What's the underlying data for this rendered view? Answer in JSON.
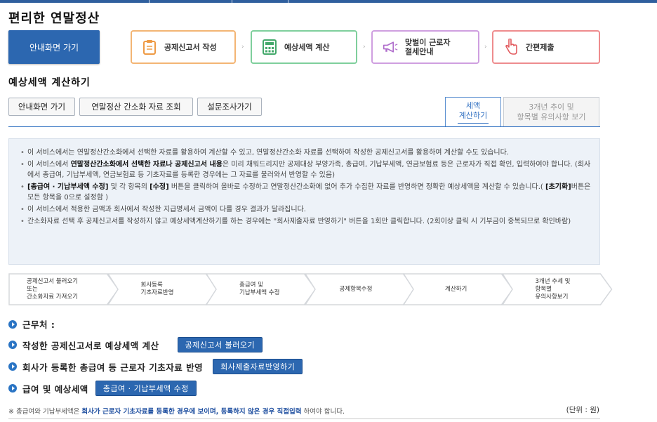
{
  "header": {
    "title": "편리한 연말정산"
  },
  "nav": {
    "home_button": "안내화면 가기",
    "steps": [
      {
        "label": "공제신고서 작성",
        "color": "#f0a55b"
      },
      {
        "label": "예상세액 계산",
        "color": "#6cc08b"
      },
      {
        "label_line1": "맞벌이 근로자",
        "label_line2": "절세안내",
        "color": "#c58fd6"
      },
      {
        "label": "간편제출",
        "color": "#e8797c"
      }
    ]
  },
  "section": {
    "title": "예상세액 계산하기",
    "buttons": [
      "안내화면 가기",
      "연말정산 간소화 자료 조회",
      "설문조사가기"
    ],
    "tabs": {
      "active_line1": "세액",
      "active_line2": "계산하기",
      "inactive_line1": "3개년 추이 및",
      "inactive_line2": "항목별 유의사항 보기"
    }
  },
  "notice": {
    "item1": "이 서비스에서는 연말정산간소화에서 선택한 자료를 활용하여 계산할 수 있고, 연말정산간소화 자료를 선택하여 작성한 공제신고서를 활용하여 계산할 수도 있습니다.",
    "item2_pre": "이 서비스에서 ",
    "item2_bold": "연말정산간소화에서 선택한 자료나 공제신고서 내용",
    "item2_post": "은 미리 채워드리지만 공제대상 부양가족, 총급여, 기납부세액, 연금보험료 등은 근로자가 직접 확인, 입력하여야 합니다. (회사에서 총급여, 기납부세액, 연금보험료 등 기초자료를 등록한 경우에는 그 자료를 불러와서 반영할 수 있음)",
    "item3_b1": "[총급여 · 기납부세액 수정]",
    "item3_mid1": " 및 각 항목의 ",
    "item3_b2": "[수정]",
    "item3_mid2": " 버튼을 클릭하여 올바로 수정하고 연말정산간소화에 없어 추가 수집한 자료를 반영하면 정확한 예상세액을 계산할 수 있습니다.( ",
    "item3_b3": "[초기화]",
    "item3_post": "버튼은 모든 항목을 0으로 설정함 )",
    "item4": "이 서비스에서 적용한 금액과 회사에서 작성한 지급명세서 금액이 다를 경우 결과가 달라집니다.",
    "item5": "간소화자료 선택 후 공제신고서를 작성하지 않고 예상세액계산하기를 하는 경우에는 \"회사제출자료 반영하기\" 버튼을 1회만 클릭합니다. (2회이상 클릭 시 기부금이 중복되므로 확인바람)"
  },
  "flow": [
    [
      "공제신고서 불러오기",
      "또는",
      "간소화자료 가져오기"
    ],
    [
      "회사등록",
      "기초자료반영"
    ],
    [
      "총급여 및",
      "기납부세액 수정"
    ],
    [
      "공제항목수정"
    ],
    [
      "계산하기"
    ],
    [
      "3개년 추세 및",
      "항목별",
      "유의사항보기"
    ]
  ],
  "rows": {
    "workplace": "근무처 :",
    "calc_label": "작성한 공제신고서로 예상세액 계산",
    "calc_button": "공제신고서 불러오기",
    "reflect_label": "회사가 등록한 총급여 등 근로자 기초자료 반영",
    "reflect_button": "회사제출자료반영하기",
    "salary_label": "급여 및 예상세액",
    "salary_button": "총급여 · 기납부세액 수정"
  },
  "footer": {
    "note_pre": "※ 총급여와 기납부세액은 ",
    "note_bold": "회사가 근로자 기초자료를 등록한 경우에 보이며, 등록하지 않은 경우 직접입력",
    "note_post": " 하여야 합니다.",
    "unit": "(단위 : 원)"
  }
}
